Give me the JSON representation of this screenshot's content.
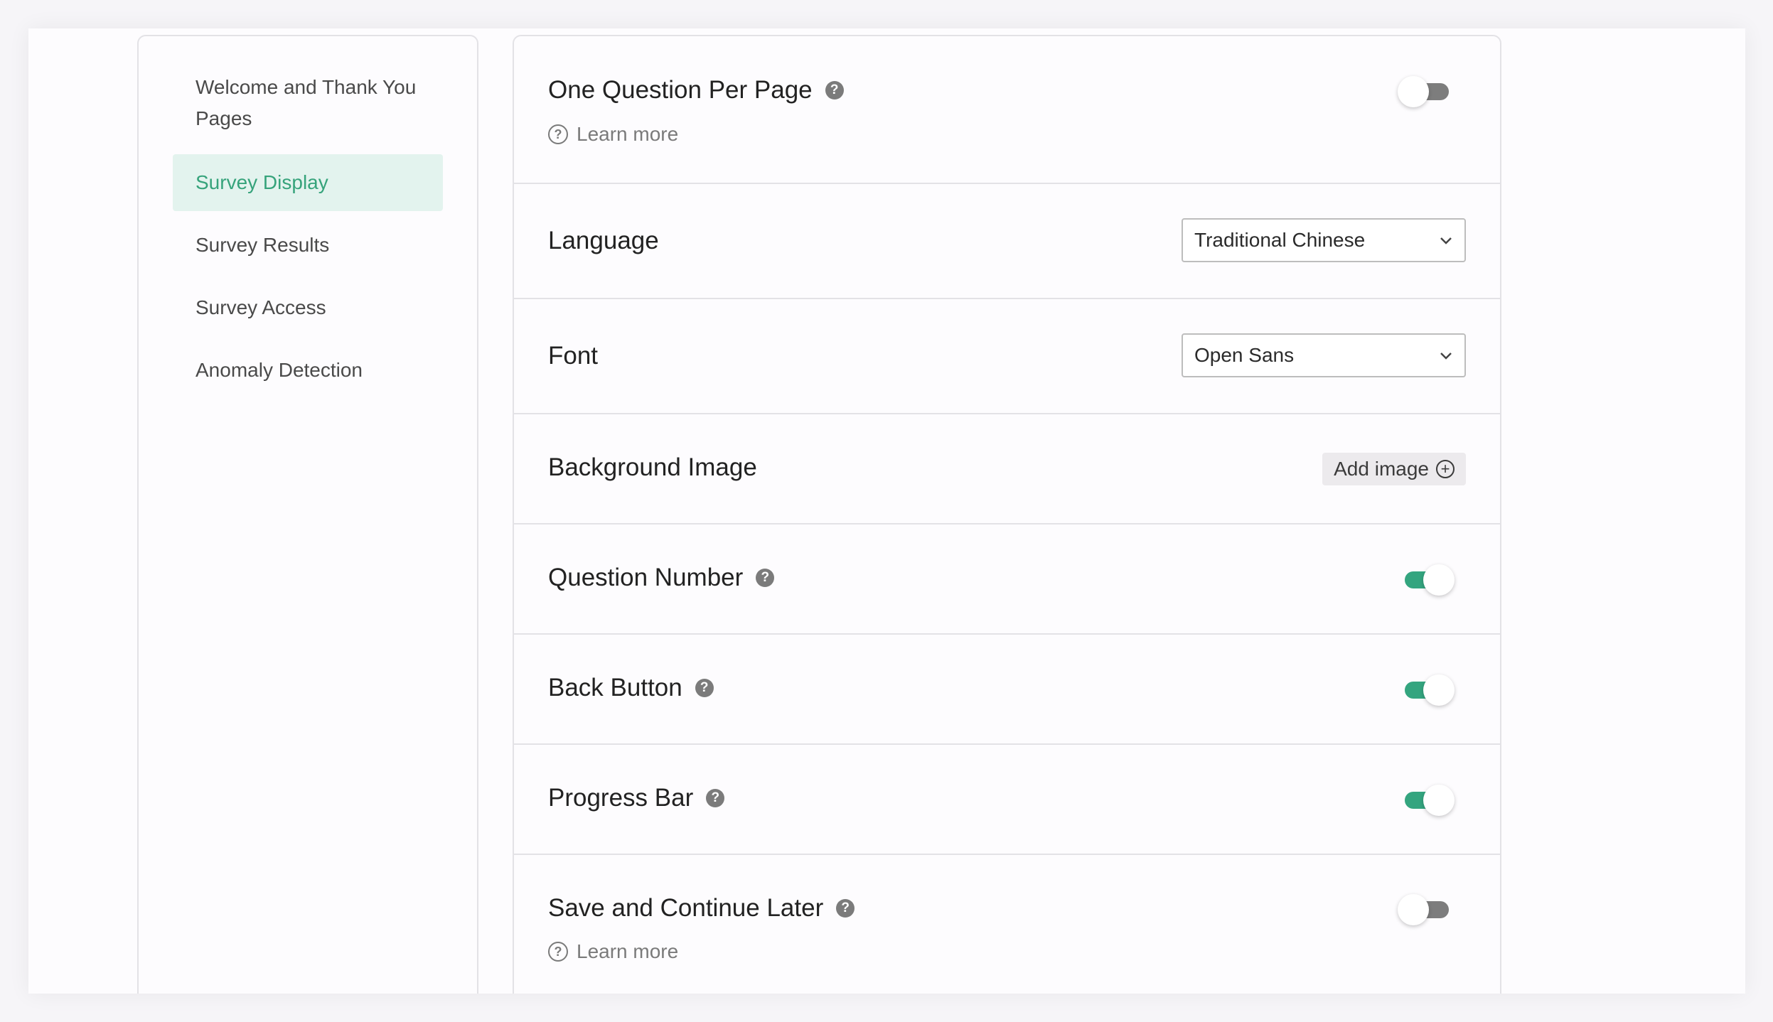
{
  "sidebar": {
    "items": [
      {
        "label": "Welcome and Thank You Pages"
      },
      {
        "label": "Survey Display"
      },
      {
        "label": "Survey Results"
      },
      {
        "label": "Survey Access"
      },
      {
        "label": "Anomaly Detection"
      }
    ]
  },
  "settings": {
    "one_question_per_page": {
      "label": "One Question Per Page",
      "learn_more": "Learn more",
      "enabled": false
    },
    "language": {
      "label": "Language",
      "value": "Traditional Chinese"
    },
    "font": {
      "label": "Font",
      "value": "Open Sans"
    },
    "background_image": {
      "label": "Background Image",
      "button": "Add image"
    },
    "question_number": {
      "label": "Question Number",
      "enabled": true
    },
    "back_button": {
      "label": "Back Button",
      "enabled": true
    },
    "progress_bar": {
      "label": "Progress Bar",
      "enabled": true
    },
    "save_continue": {
      "label": "Save and Continue Later",
      "learn_more": "Learn more",
      "enabled": false
    }
  },
  "colors": {
    "accent": "#34a57f",
    "active_bg": "#e3f3ee",
    "toggle_off": "#7d7d7d"
  }
}
